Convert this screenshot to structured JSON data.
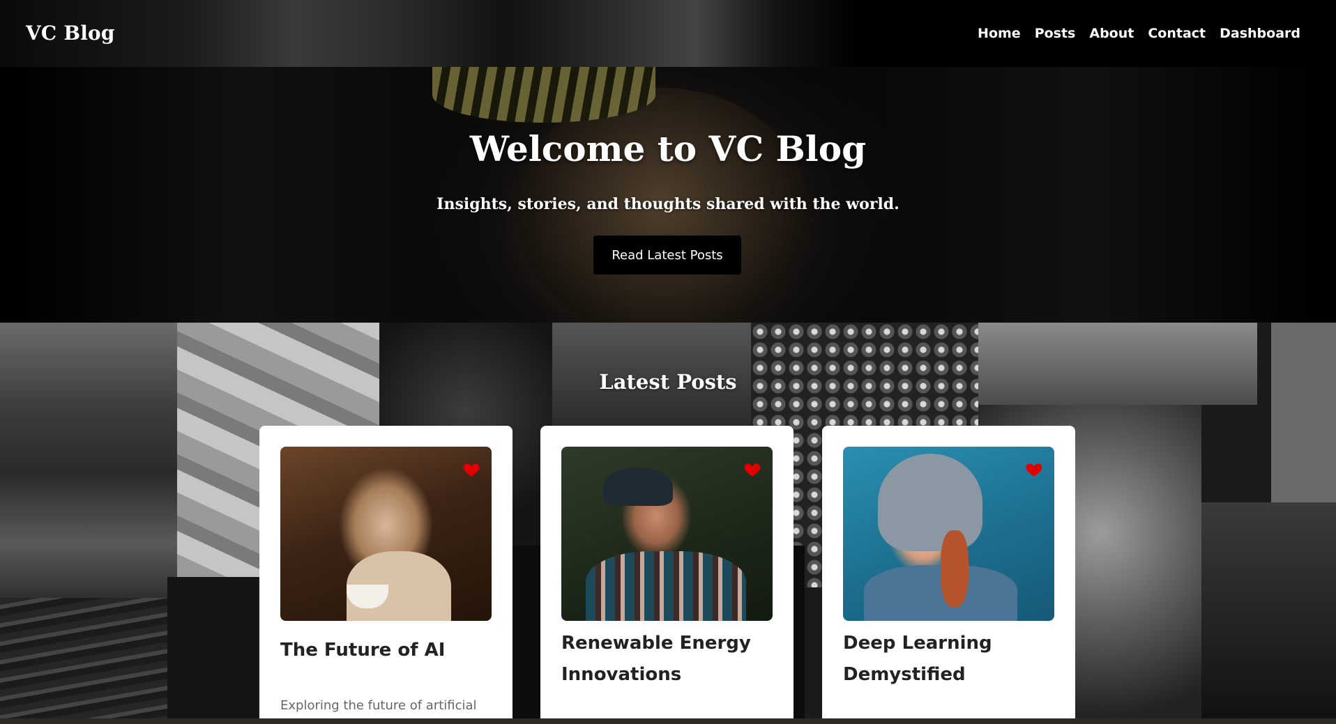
{
  "navbar": {
    "brand": "VC Blog",
    "links": [
      "Home",
      "Posts",
      "About",
      "Contact",
      "Dashboard"
    ]
  },
  "hero": {
    "title": "Welcome to VC Blog",
    "subtitle": "Insights, stories, and thoughts shared with the world.",
    "button_label": "Read Latest Posts"
  },
  "posts": {
    "section_title": "Latest Posts",
    "cards": [
      {
        "title": "The Future of AI",
        "excerpt": "Exploring the future of artificial",
        "image": "woman-with-coffee-photo",
        "liked_icon": "heart-icon"
      },
      {
        "title": "Renewable Energy Innovations",
        "excerpt": "",
        "image": "man-in-beanie-photo",
        "liked_icon": "heart-icon"
      },
      {
        "title": "Deep Learning Demystified",
        "excerpt": "",
        "image": "woman-in-hoodie-photo",
        "liked_icon": "heart-icon"
      }
    ]
  },
  "colors": {
    "heart": "#e00000",
    "nav_bg": "#000000",
    "card_bg": "#ffffff",
    "button_bg": "#000000"
  }
}
